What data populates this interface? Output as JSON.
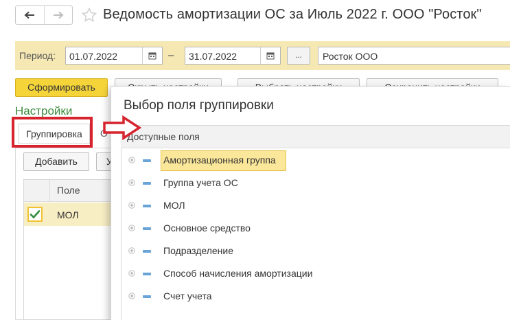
{
  "window": {
    "title": "Ведомость амортизации ОС за Июль 2022 г. ООО \"Росток\"",
    "back_icon": "arrow-left-icon",
    "forward_icon": "arrow-right-icon",
    "favorite_icon": "star-icon"
  },
  "period": {
    "label": "Период:",
    "start": "01.07.2022",
    "separator": "–",
    "end": "31.07.2022",
    "more_label": "...",
    "organization": "Росток ООО"
  },
  "toolbar": {
    "generate_label": "Сформировать",
    "hide_settings_label": "Скрыть настройки",
    "choose_settings_label": "Выбрать настройки",
    "save_settings_label": "Сохранить настройки"
  },
  "settings": {
    "title": "Настройки",
    "tab_grouping": "Группировка",
    "tab_next_partial": "О",
    "add_label": "Добавить",
    "partial_button": "У",
    "column_field": "Поле",
    "rows": [
      {
        "label": "МОЛ",
        "checked": true
      }
    ]
  },
  "dialog": {
    "title": "Выбор поля группировки",
    "available_fields_label": "Доступные поля",
    "fields": [
      {
        "label": "Амортизационная группа",
        "selected": true
      },
      {
        "label": "Группа учета ОС",
        "selected": false
      },
      {
        "label": "МОЛ",
        "selected": false
      },
      {
        "label": "Основное средство",
        "selected": false
      },
      {
        "label": "Подразделение",
        "selected": false
      },
      {
        "label": "Способ начисления амортизации",
        "selected": false
      },
      {
        "label": "Счет учета",
        "selected": false
      }
    ]
  },
  "colors": {
    "accent_yellow": "#f5d43a",
    "panel_yellow": "#f5e8b3",
    "selection_yellow": "#fbe79a",
    "highlight_red": "#d6232e",
    "settings_green": "#3c8b3c"
  }
}
